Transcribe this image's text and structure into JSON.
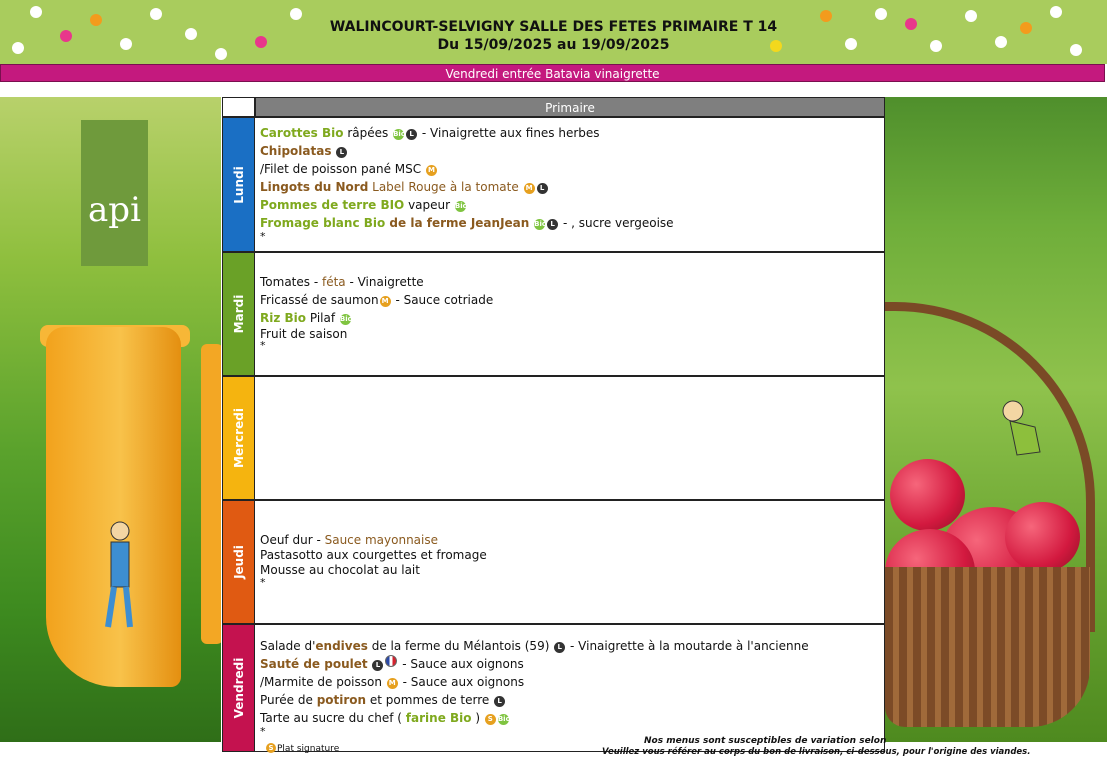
{
  "header": {
    "title_line1": "WALINCOURT-SELVIGNY SALLE DES FETES PRIMAIRE T 14",
    "title_line2": "Du 15/09/2025 au 19/09/2025",
    "band": "Vendredi entrée Batavia vinaigrette",
    "colors": {
      "header_bg": "#a9cc5d",
      "band_bg": "#c4197e"
    }
  },
  "logo": {
    "text": "api"
  },
  "table": {
    "column_header": "Primaire",
    "days": [
      {
        "name": "Lundi",
        "color": "#1a6fc4"
      },
      {
        "name": "Mardi",
        "color": "#6aa127"
      },
      {
        "name": "Mercredi",
        "color": "#f5b40f"
      },
      {
        "name": "Jeudi",
        "color": "#e05a12"
      },
      {
        "name": "Vendredi",
        "color": "#c4124f"
      }
    ],
    "lundi": {
      "l1a": "Carottes Bio",
      "l1b": " râpées ",
      "l1c": " - Vinaigrette aux fines herbes",
      "l2": "Chipolatas",
      "l3": "/Filet de poisson pané  MSC ",
      "l4a": "Lingots du Nord",
      "l4b": " Label Rouge à la tomate ",
      "l5a": "Pommes de terre BIO",
      "l5b": " vapeur ",
      "l6a": "Fromage blanc Bio",
      "l6b": " de la ferme JeanJean",
      "l6c": " - , sucre vergeoise",
      "star": "*"
    },
    "mardi": {
      "l1a": "Tomates",
      "l1b": " - ",
      "l1c": "féta",
      "l1d": " - Vinaigrette",
      "l2a": "Fricassé de saumon",
      "l2b": " - Sauce cotriade",
      "l3a": "Riz Bio",
      "l3b": " Pilaf ",
      "l4": "Fruit de saison",
      "star": "*"
    },
    "jeudi": {
      "l1a": "Oeuf dur",
      "l1b": " - ",
      "l1c": "Sauce mayonnaise",
      "l2": "Pastasotto aux courgettes et fromage",
      "l3": "Mousse au chocolat au lait",
      "star": "*"
    },
    "vendredi": {
      "l1a": "Salade d'",
      "l1b": "endives",
      "l1c": " de la ferme du Mélantois (59) ",
      "l1d": " - Vinaigrette à la moutarde à l'ancienne",
      "l2a": "Sauté de poulet",
      "l2b": " - Sauce aux oignons",
      "l3": "/Marmite de poisson ",
      "l3b": " - Sauce aux oignons",
      "l4a": "Purée de ",
      "l4b": "potiron",
      "l4c": " et pommes de terre ",
      "l5a": "Tarte au sucre du chef  ( ",
      "l5b": "farine Bio",
      "l5c": " ) ",
      "star": "*"
    }
  },
  "badges": {
    "bio": "Bio",
    "msc": "M",
    "loc": "L",
    "signature": "S"
  },
  "footer": {
    "note1": "Nos menus sont susceptibles de variation selon",
    "note2": "Veuillez vous référer au corps du bon de livraison, ci-dessous, pour l'origine des viandes.",
    "legend": "Plat signature"
  }
}
